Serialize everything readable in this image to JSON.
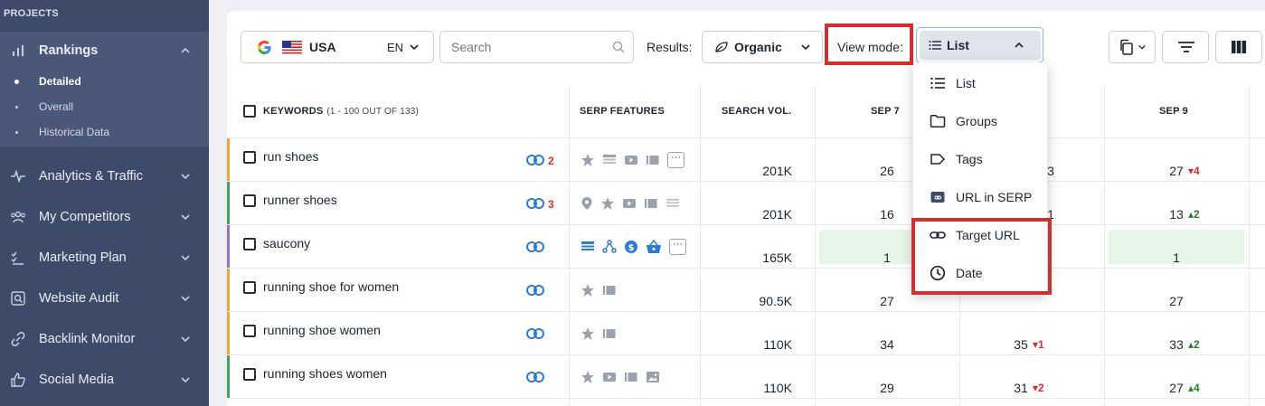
{
  "sidebar": {
    "header": "PROJECTS",
    "rankings": "Rankings",
    "subitems": [
      "Detailed",
      "Overall",
      "Historical Data"
    ],
    "items": [
      "Analytics & Traffic",
      "My Competitors",
      "Marketing Plan",
      "Website Audit",
      "Backlink Monitor",
      "Social Media"
    ]
  },
  "toolbar": {
    "country": "USA",
    "language": "EN",
    "search_placeholder": "Search",
    "results_label": "Results:",
    "results_value": "Organic",
    "view_mode_label": "View mode:",
    "view_mode_value": "List"
  },
  "dropdown": {
    "items": [
      "List",
      "Groups",
      "Tags",
      "URL in SERP",
      "Target URL",
      "Date"
    ]
  },
  "table": {
    "headers": {
      "keywords": "KEYWORDS",
      "keywords_count": "(1 - 100 OUT OF 133)",
      "serp": "SERP FEATURES",
      "volume": "SEARCH VOL.",
      "date1": "SEP 7",
      "date3": "SEP 9"
    },
    "rows": [
      {
        "keyword": "run shoes",
        "links": "2",
        "volume": "201K",
        "sep7": "26",
        "sep8": "3",
        "sep9": "27",
        "sep9_delta": "4"
      },
      {
        "keyword": "runner shoes",
        "links": "3",
        "volume": "201K",
        "sep7": "16",
        "sep8": "1",
        "sep9": "13",
        "sep9_delta": "2"
      },
      {
        "keyword": "saucony",
        "links": "",
        "volume": "165K",
        "sep7": "1",
        "sep8": "",
        "sep9": "1",
        "sep9_delta": ""
      },
      {
        "keyword": "running shoe for women",
        "links": "",
        "volume": "90.5K",
        "sep7": "27",
        "sep8": "",
        "sep9": "27",
        "sep9_delta": ""
      },
      {
        "keyword": "running shoe women",
        "links": "",
        "volume": "110K",
        "sep7": "34",
        "sep8": "35",
        "sep8_delta": "1",
        "sep9": "33",
        "sep9_delta": "2"
      },
      {
        "keyword": "running shoes women",
        "links": "",
        "volume": "110K",
        "sep7": "29",
        "sep8": "31",
        "sep8_delta": "2",
        "sep9": "27",
        "sep9_delta": "4"
      }
    ]
  },
  "colors": {
    "sidebar": "#3e4a6a",
    "highlight": "#d32f2f",
    "link": "#2b7cd3",
    "up": "#2e7d32",
    "down": "#d32f2f"
  }
}
